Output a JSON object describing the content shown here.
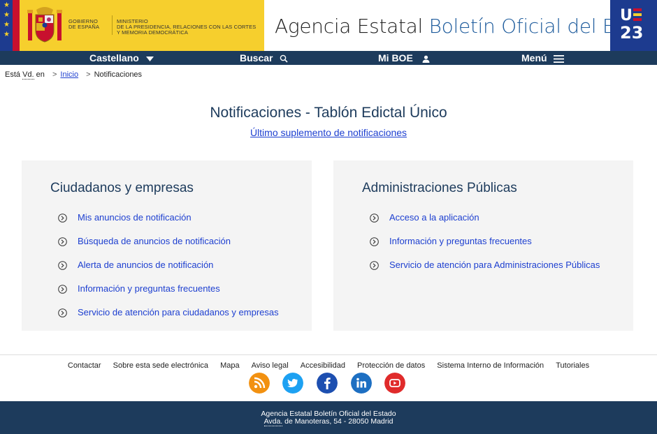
{
  "header": {
    "gov_line1": "GOBIERNO",
    "gov_line2": "DE ESPAÑA",
    "ministry_line1": "MINISTERIO",
    "ministry_line2": "DE LA PRESIDENCIA, RELACIONES CON LAS CORTES",
    "ministry_line3": "Y MEMORIA DEMOCRÁTICA",
    "agency_part1": "Agencia Estatal",
    "agency_part2": "Boletín Oficial del Estado",
    "badge_text": "U\n23",
    "colors": {
      "gov_yellow": "#f6cf2d",
      "eu_blue": "#1d3b8f",
      "spain_red": "#c8102e",
      "agency_blue": "#1d5b9c"
    }
  },
  "nav": {
    "language": "Castellano",
    "search": "Buscar",
    "my_boe": "Mi BOE",
    "menu": "Menú",
    "bg_color": "#1d3b5c"
  },
  "breadcrumb": {
    "prefix_1": "Está ",
    "prefix_abbr": "Vd.",
    "prefix_2": " en",
    "home": "Inicio",
    "current": "Notificaciones"
  },
  "page": {
    "title": "Notificaciones - Tablón Edictal Único",
    "supplement_link": "Último suplemento de notificaciones"
  },
  "panels": [
    {
      "title": "Ciudadanos y empresas",
      "links": [
        "Mis anuncios de notificación",
        "Búsqueda de anuncios de notificación",
        "Alerta de anuncios de notificación",
        "Información y preguntas frecuentes",
        "Servicio de atención para ciudadanos y empresas"
      ]
    },
    {
      "title": "Administraciones Públicas",
      "links": [
        "Acceso a la aplicación",
        "Información y preguntas frecuentes",
        "Servicio de atención para Administraciones Públicas"
      ]
    }
  ],
  "footer": {
    "links": [
      "Contactar",
      "Sobre esta sede electrónica",
      "Mapa",
      "Aviso legal",
      "Accesibilidad",
      "Protección de datos",
      "Sistema Interno de Información",
      "Tutoriales"
    ],
    "social": [
      {
        "name": "rss-icon",
        "color": "#f29111"
      },
      {
        "name": "twitter-icon",
        "color": "#1da1f2"
      },
      {
        "name": "facebook-icon",
        "color": "#1d4fb0"
      },
      {
        "name": "linkedin-icon",
        "color": "#1d6fc2"
      },
      {
        "name": "youtube-icon",
        "color": "#e02b2b"
      }
    ],
    "org_name": "Agencia Estatal Boletín Oficial del Estado",
    "address_abbr": "Avda.",
    "address_rest": " de Manoteras, 54 - 28050 Madrid"
  }
}
